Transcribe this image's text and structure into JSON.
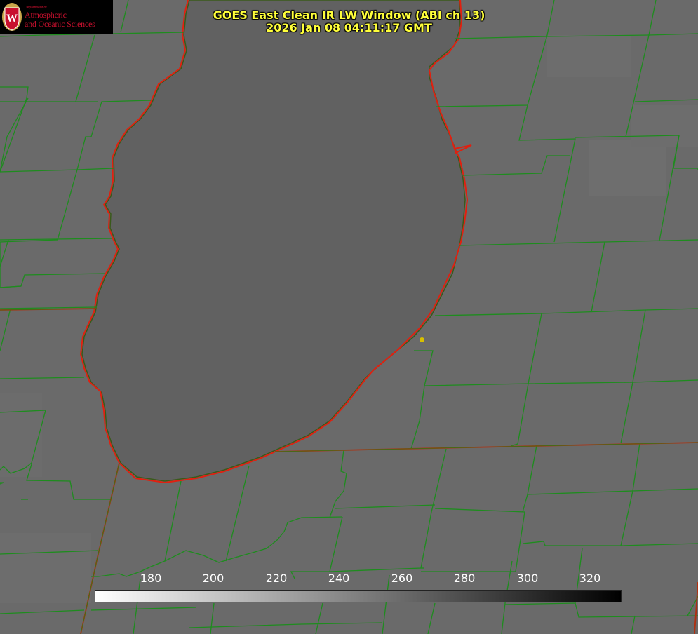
{
  "logo": {
    "dept_text": "Department of",
    "line1": "Atmospheric",
    "line2": "and Oceanic Sciences",
    "seal_letter": "W",
    "brand_color": "#c8102e"
  },
  "title": {
    "line1": "GOES East Clean IR LW Window (ABI ch 13)",
    "line2": "2026 Jan 08 04:11:17 GMT",
    "color": "#ffff3a"
  },
  "colorbar": {
    "ticks": [
      "180",
      "200",
      "220",
      "240",
      "260",
      "280",
      "300",
      "320"
    ],
    "gradient": [
      "#ffffff",
      "#000000"
    ]
  },
  "map": {
    "land_color": "#6a6a6a",
    "lake_color": "#616161",
    "county_border_color": "#1e8c1e",
    "state_border_color": "#e02010",
    "marker_color": "#d8c000"
  }
}
